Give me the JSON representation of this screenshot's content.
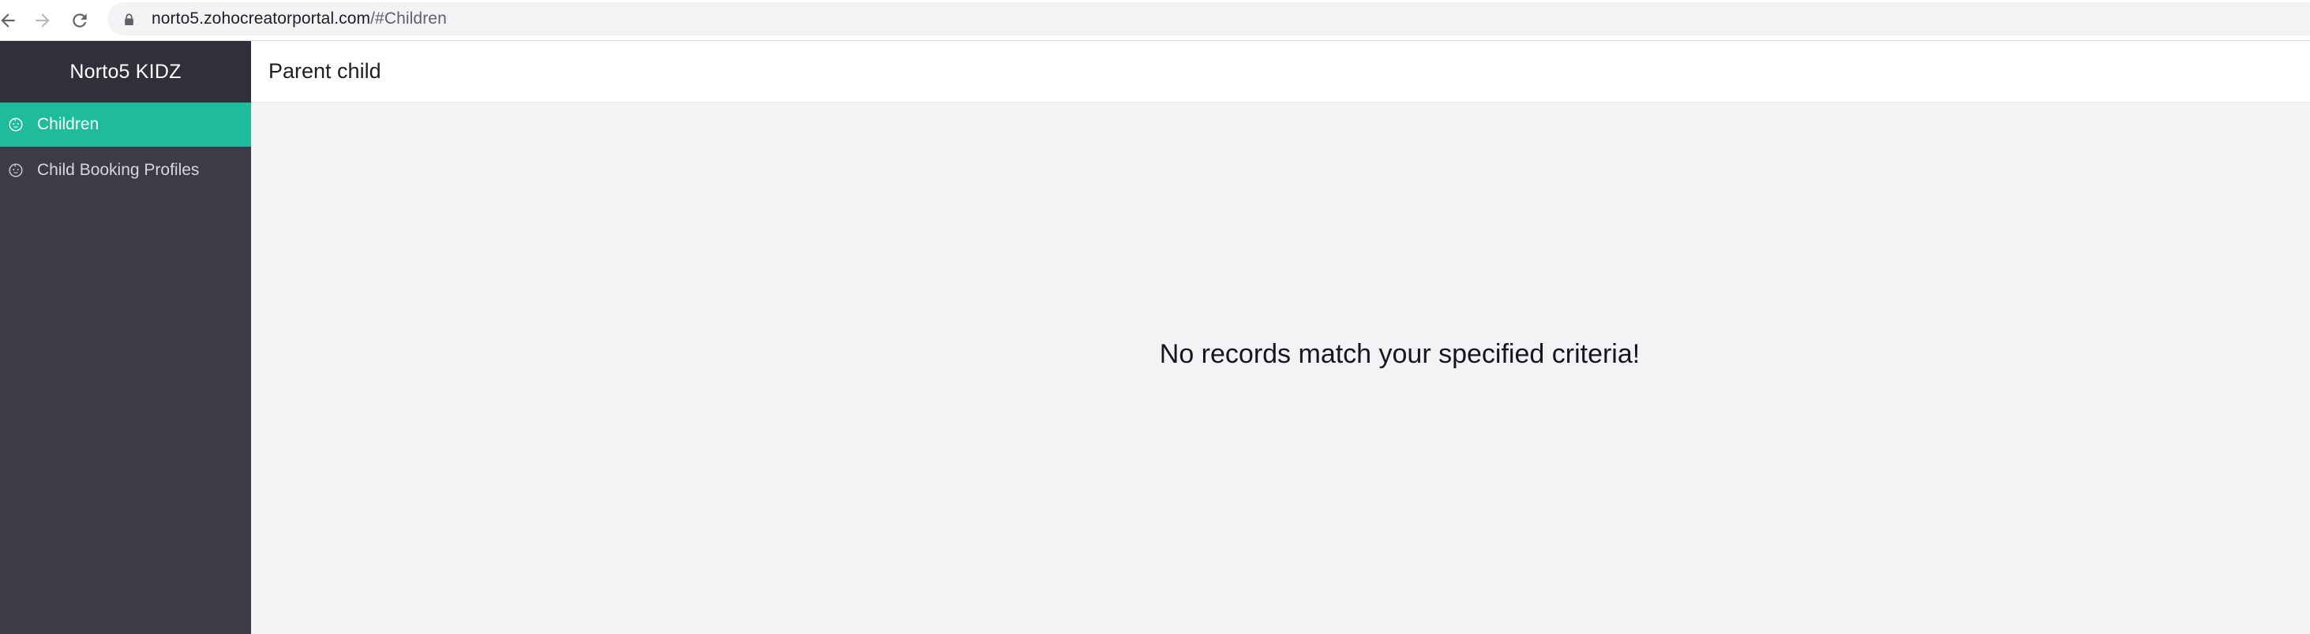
{
  "browser": {
    "url_host": "norto5.zohocreatorportal.com",
    "url_path": "/#Children",
    "icons": {
      "back": "arrow-left-icon",
      "forward": "arrow-right-icon",
      "reload": "reload-icon",
      "lock": "lock-icon"
    }
  },
  "sidebar": {
    "app_name": "Norto5 KIDZ",
    "items": [
      {
        "label": "Children",
        "icon": "child-face-icon",
        "active": true
      },
      {
        "label": "Child Booking Profiles",
        "icon": "child-face-icon",
        "active": false
      }
    ]
  },
  "header": {
    "title": "Parent child"
  },
  "main": {
    "empty_message": "No records match your specified criteria!"
  },
  "colors": {
    "sidebar_bg": "#3b3c46",
    "sidebar_header_bg": "#2f3039",
    "active_item": "#1ebc9b",
    "content_bg": "#f2f3f5"
  }
}
